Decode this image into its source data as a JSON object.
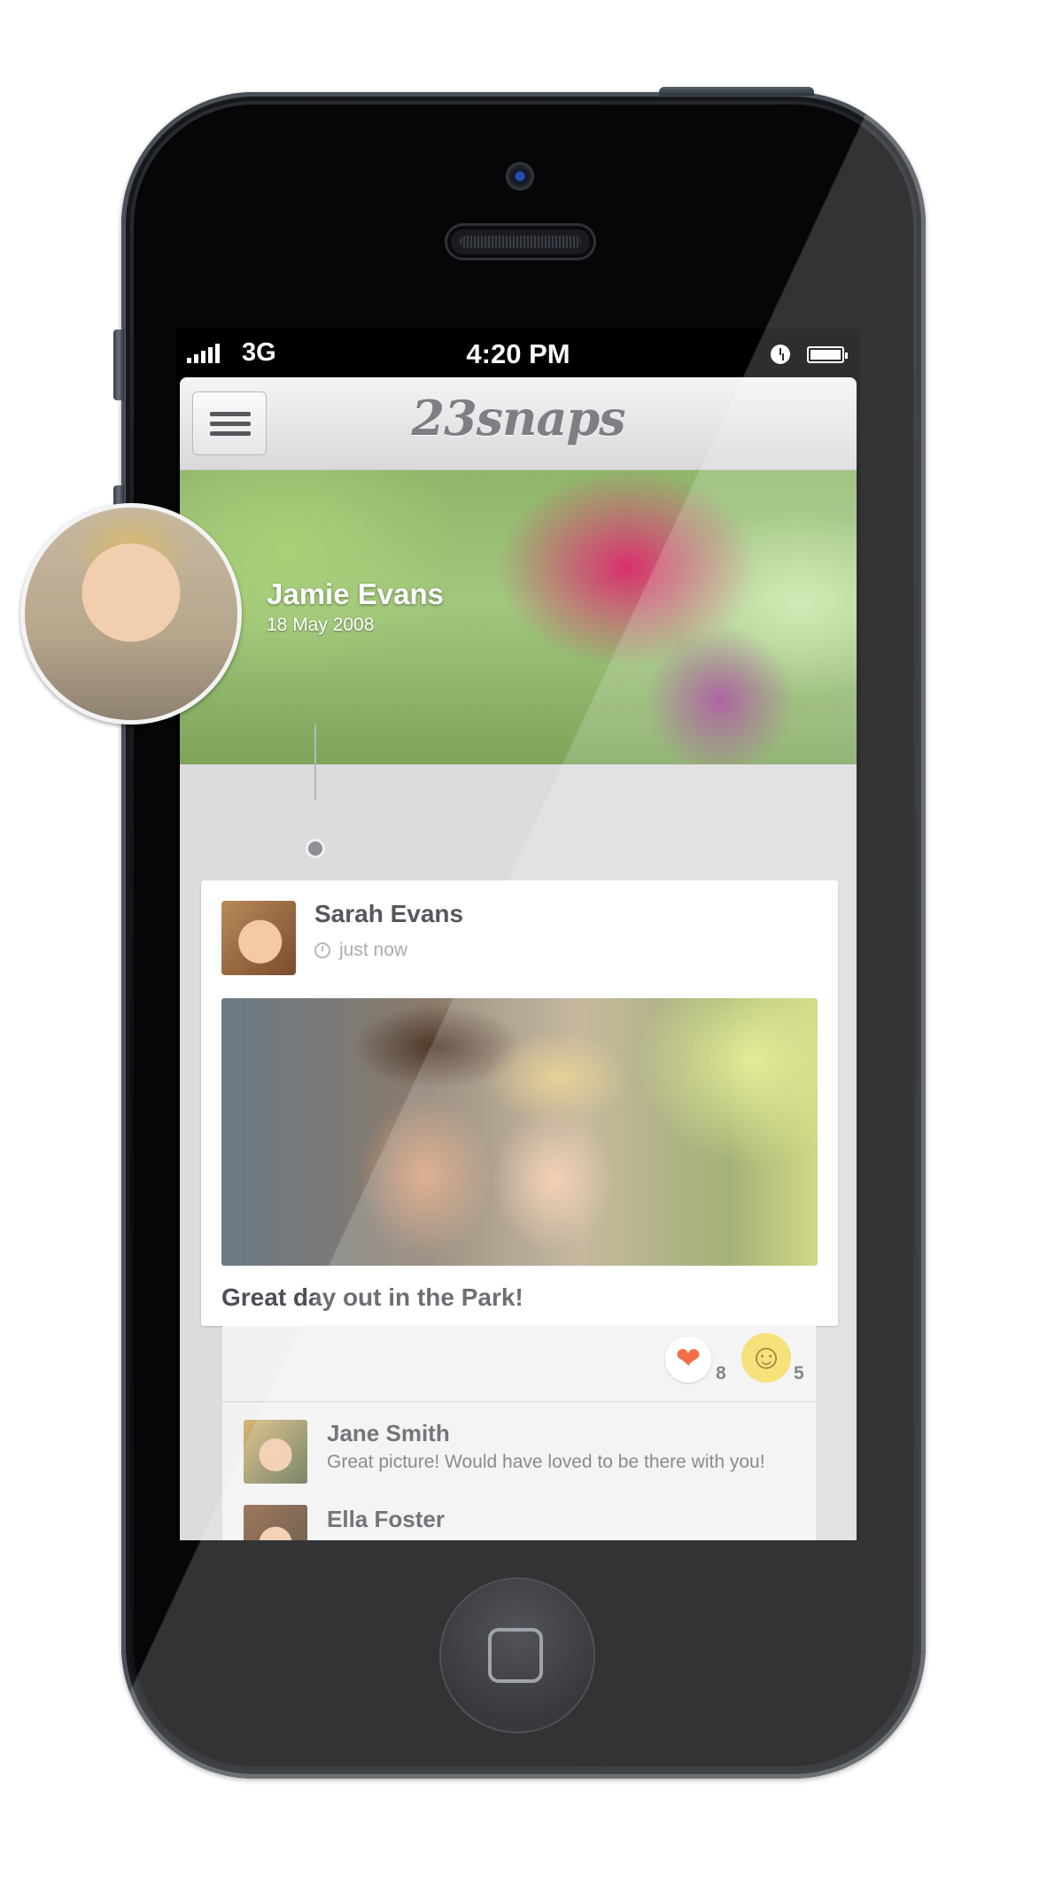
{
  "status_bar": {
    "network": "3G",
    "time": "4:20 PM",
    "icons": [
      "signal-bars-icon",
      "alarm-clock-icon",
      "battery-icon"
    ]
  },
  "navbar": {
    "menu_icon": "hamburger-menu-icon",
    "logo_text": "23snaps"
  },
  "profile": {
    "name": "Jamie Evans",
    "date": "18 May 2008"
  },
  "post": {
    "author": "Sarah Evans",
    "time": "just now",
    "caption": "Great day out in the Park!",
    "reactions": {
      "heart_icon": "heart-icon",
      "heart_count": "8",
      "smile_icon": "smiley-icon",
      "smile_count": "5"
    }
  },
  "comments": [
    {
      "name": "Jane Smith",
      "text": "Great picture! Would have loved to be there with you!"
    },
    {
      "name": "Ella Foster",
      "text": ""
    }
  ],
  "colors": {
    "heart": "#f04e1e",
    "smile": "#f4dc5e",
    "text_dark": "#55575e",
    "background": "#dcdcde"
  }
}
